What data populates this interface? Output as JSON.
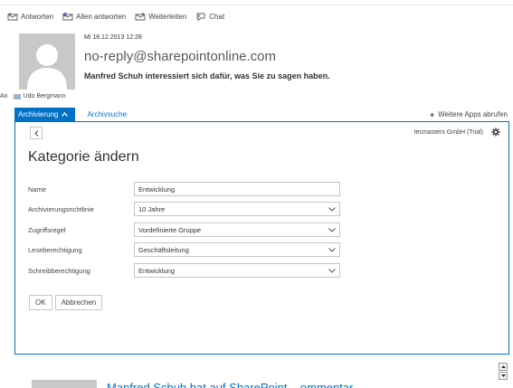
{
  "toolbar": {
    "reply": "Antworten",
    "reply_all": "Allen antworten",
    "forward": "Weiterleiten",
    "chat": "Chat"
  },
  "message": {
    "date": "Mi 18.12.2013 12:28",
    "from": "no-reply@sharepointonline.com",
    "subject": "Manfred Schuh interessiert sich dafür, was Sie zu sagen haben.",
    "to_label": "An",
    "recipient": "Udo Bergmann"
  },
  "apps": {
    "active_tab": "Archivierung",
    "second_tab": "Archivsuche",
    "more_apps": "Weitere Apps abrufen"
  },
  "panel": {
    "tenant": "tecmasters GmbH (Trial)",
    "title": "Kategorie ändern",
    "fields": [
      {
        "label": "Name",
        "value": "Entwicklung"
      },
      {
        "label": "Archivierungsrichtlinie",
        "value": "10 Jahre"
      },
      {
        "label": "Zugriffsregel",
        "value": "Vordefinierte Gruppe"
      },
      {
        "label": "Leseberechtigung",
        "value": "Geschäftsleitung"
      },
      {
        "label": "Schreibberechtigung",
        "value": "Entwicklung"
      }
    ],
    "ok": "OK",
    "cancel": "Abbrechen"
  },
  "preview": {
    "text": "Manfred Schuh hat auf SharePoint ...ommentar"
  },
  "colors": {
    "accent": "#0072c6",
    "border": "#c6c6c6"
  }
}
